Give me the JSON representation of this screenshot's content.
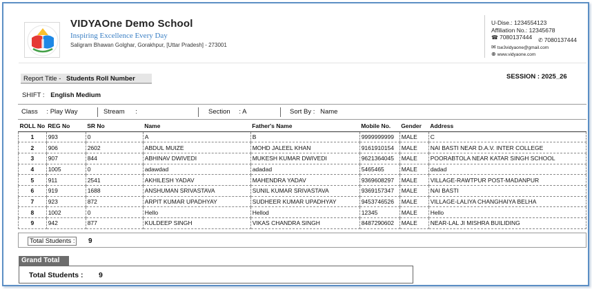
{
  "school": {
    "name": "VIDYAOne Demo School",
    "tagline": "Inspiring Excellence Every Day",
    "address": "Saligram Bhawan Golghar, Gorakhpur, [Uttar Pradesh] - 273001"
  },
  "contact": {
    "udise": "U-Dise.: 1234554123",
    "affiliation": "Affiliation No.: 12345678",
    "phone1": "7080137444",
    "phone2": "7080137444",
    "email": "tse3vidyaone@gmail.com",
    "website": "www.vidyaone.com",
    "icons": [
      "phone-icon",
      "mobile-icon",
      "email-icon",
      "web-icon"
    ]
  },
  "report": {
    "title_label": "Report Title -",
    "title_value": "Students Roll Number",
    "session_label": "SESSION",
    "session_value": "2025_26",
    "shift_label": "SHIFT :",
    "shift_value": "English Medium"
  },
  "filters": {
    "class_label": "Class",
    "class_value": "Play Way",
    "stream_label": "Stream",
    "stream_value": "",
    "section_label": "Section",
    "section_value": "A",
    "sortby_label": "Sort By :",
    "sortby_value": "Name"
  },
  "table": {
    "headers": [
      "ROLL No",
      "REG No",
      "SR No",
      "Name",
      "Father's Name",
      "Mobile No.",
      "Gender",
      "Address"
    ],
    "rows": [
      [
        "1",
        "993",
        "0",
        "A",
        "B",
        "9999999999",
        "MALE",
        "C"
      ],
      [
        "2",
        "906",
        "2602",
        "ABDUL MUIZE",
        "MOHD JALEEL KHAN",
        "9161910154",
        "MALE",
        "NAI BASTI NEAR D.A.V. INTER COLLEGE"
      ],
      [
        "3",
        "907",
        "844",
        "ABHINAV DWIVEDI",
        "MUKESH KUMAR DWIVEDI",
        "9621364045",
        "MALE",
        "POORABTOLA NEAR KATAR SINGH SCHOOL"
      ],
      [
        "4",
        "1005",
        "0",
        "adawdad",
        "adadad",
        "5465465",
        "MALE",
        "dadad"
      ],
      [
        "5",
        "911",
        "2541",
        "AKHILESH YADAV",
        "MAHENDRA YADAV",
        "9369608297",
        "MALE",
        "VILLAGE-RAWTPUR POST-MADANPUR"
      ],
      [
        "6",
        "919",
        "1688",
        "ANSHUMAN SRIVASTAVA",
        "SUNIL KUMAR SRIVASTAVA",
        "9369157347",
        "MALE",
        "NAI BASTI"
      ],
      [
        "7",
        "923",
        "872",
        "ARPIT KUMAR UPADHYAY",
        "SUDHEER KUMAR UPADHYAY",
        "9453746526",
        "MALE",
        "VILLAGE-LALIYA CHANGHAIYA BELHA"
      ],
      [
        "8",
        "1002",
        "0",
        "Hello",
        "Hellod",
        "12345",
        "MALE",
        "Hello"
      ],
      [
        "9",
        "942",
        "877",
        "KULDEEP SINGH",
        "VIKAS CHANDRA SINGH",
        "8487290602",
        "MALE",
        "NEAR-LAL JI MISHRA BUILIDING"
      ]
    ]
  },
  "totals": {
    "label": "Total Students :",
    "count": "9",
    "grand_title": "Grand Total",
    "grand_label": "Total Students :",
    "grand_count": "9"
  },
  "colors": {
    "frame": "#5b8ec4",
    "tagline": "#3a7fc4",
    "grand_total_bg": "#6d6d6d"
  }
}
